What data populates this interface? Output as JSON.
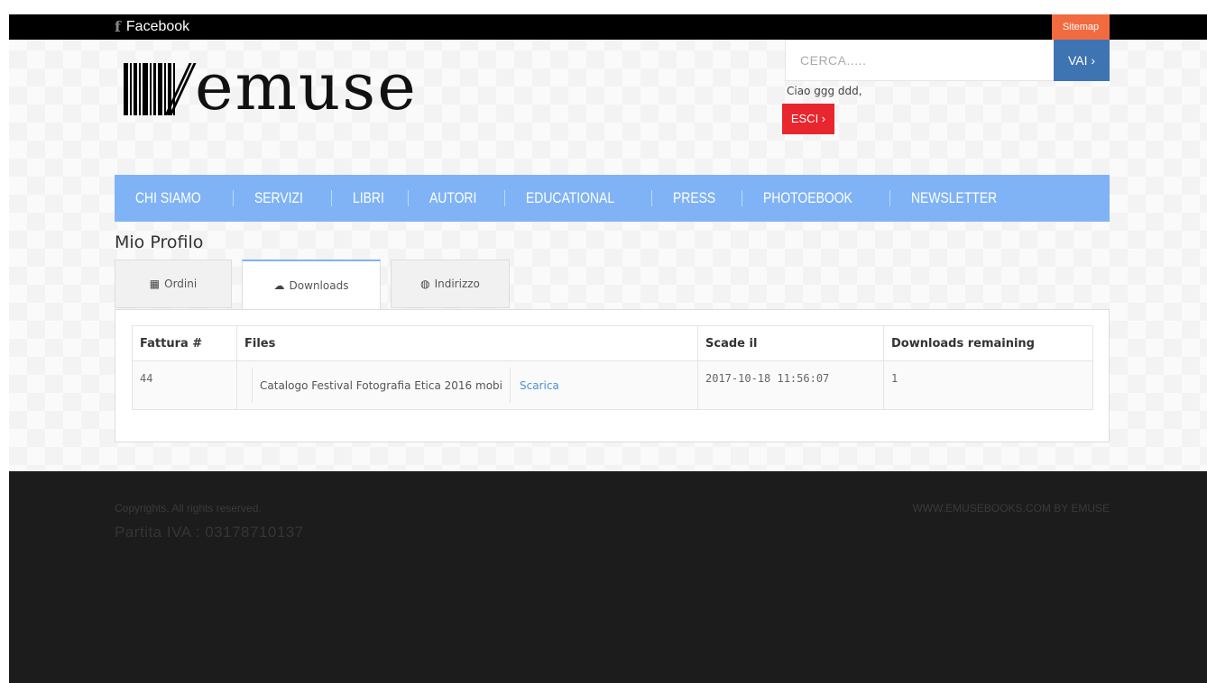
{
  "topbar": {
    "facebook_label": "Facebook",
    "sitemap_label": "Sitemap"
  },
  "logo": {
    "text": "emuse"
  },
  "search": {
    "placeholder": "CERCA.....",
    "button_label": "VAI ›"
  },
  "user": {
    "greeting": "Ciao ggg ddd,",
    "logout_label": "ESCI ›"
  },
  "nav": {
    "items": [
      "CHI SIAMO",
      "SERVIZI",
      "LIBRI",
      "AUTORI",
      "EDUCATIONAL",
      "PRESS",
      "PHOTOEBOOK",
      "NEWSLETTER"
    ]
  },
  "page_title": "Mio Profilo",
  "tabs": [
    {
      "label": "Ordini",
      "icon": "grid-icon"
    },
    {
      "label": "Downloads",
      "icon": "cloud-download-icon",
      "active": true
    },
    {
      "label": "Indirizzo",
      "icon": "globe-icon"
    }
  ],
  "downloads_table": {
    "headers": [
      "Fattura #",
      "Files",
      "Scade il",
      "Downloads remaining"
    ],
    "rows": [
      {
        "invoice": "44",
        "file_name": "Catalogo Festival Fotografia Etica 2016 mobi",
        "file_link": "Scarica",
        "expires": "2017-10-18 11:56:07",
        "remaining": "1"
      }
    ]
  },
  "footer": {
    "copyright": "Copyrights. All rights reserved.",
    "vat": "Partita IVA : 03178710137",
    "credit": "WWW.EMUSEBOOKS.COM BY EMUSE"
  },
  "colors": {
    "nav_bg": "#7fb3f5",
    "sitemap_bg": "#f26a3f",
    "search_button_bg": "#3f74b3",
    "logout_bg": "#e8262d",
    "link": "#4a90d9",
    "footer_bg": "#1c1c1c"
  }
}
